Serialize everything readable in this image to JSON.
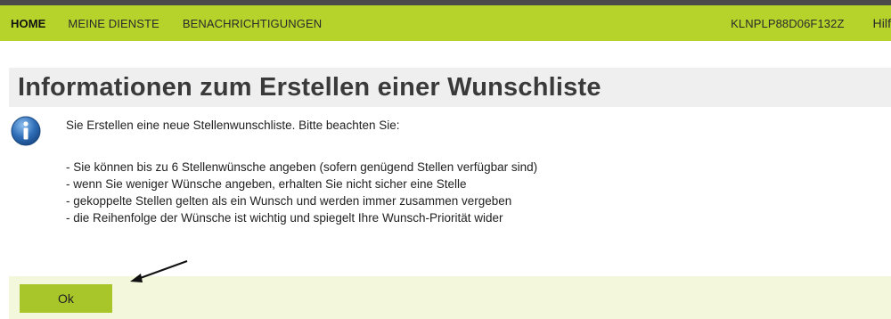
{
  "nav": {
    "home": "HOME",
    "services": "MEINE DIENSTE",
    "notifications": "BENACHRICHTIGUNGEN",
    "user_id": "KLNPLP88D06F132Z",
    "help": "Hilfe"
  },
  "title": "Informationen zum Erstellen einer Wunschliste",
  "message": {
    "intro": "Sie Erstellen eine neue Stellenwunschliste. Bitte beachten Sie:",
    "items": [
      "- Sie können bis zu 6 Stellenwünsche angeben (sofern genügend Stellen verfügbar sind)",
      "- wenn Sie weniger Wünsche angeben, erhalten Sie nicht sicher eine Stelle",
      "- gekoppelte Stellen gelten als ein Wunsch und werden immer zusammen vergeben",
      "- die Reihenfolge der Wünsche ist wichtig und spiegelt Ihre Wunsch-Priorität wider"
    ]
  },
  "actions": {
    "ok_label": "Ok"
  },
  "icons": {
    "info": "info-icon",
    "arrow": "arrow-annotation"
  },
  "colors": {
    "nav_background": "#b6d32c",
    "button": "#a8c52a",
    "action_bar": "#f3f8dc",
    "title_bar": "#efefef",
    "info_icon": "#2f6fb8"
  }
}
